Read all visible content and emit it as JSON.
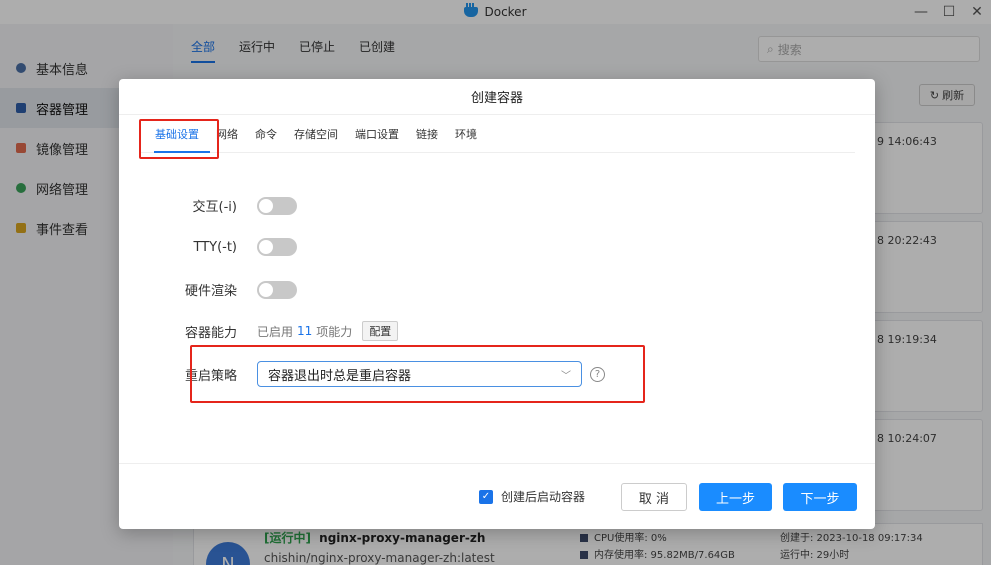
{
  "window": {
    "title": "Docker",
    "min": "—",
    "max": "☐",
    "close": "✕"
  },
  "sidebar": {
    "items": [
      {
        "label": "基本信息",
        "color": "#4a6fa5"
      },
      {
        "label": "容器管理",
        "color": "#2f5da8"
      },
      {
        "label": "镜像管理",
        "color": "#e06a4e"
      },
      {
        "label": "网络管理",
        "color": "#3aa35a"
      },
      {
        "label": "事件查看",
        "color": "#d9a520"
      }
    ]
  },
  "main": {
    "tabs": [
      "全部",
      "运行中",
      "已停止",
      "已创建"
    ],
    "search_placeholder": "搜索",
    "refresh_label": "刷新",
    "card_times": [
      "9 14:06:43",
      "8 20:22:43",
      "8 19:19:34",
      "8 10:24:07"
    ],
    "bottom_card": {
      "avatar": "N",
      "status": "[运行中]",
      "name": "nginx-proxy-manager-zh",
      "image": "chishin/nginx-proxy-manager-zh:latest",
      "cpu": "CPU使用率: 0%",
      "mem": "内存使用率: 95.82MB/7.64GB",
      "created": "创建于:  2023-10-18 09:17:34",
      "uptime": "运行中:  29小时"
    }
  },
  "dialog": {
    "title": "创建容器",
    "tabs": [
      "基础设置",
      "网络",
      "命令",
      "存储空间",
      "端口设置",
      "链接",
      "环境"
    ],
    "fields": {
      "interactive_label": "交互(-i)",
      "tty_label": "TTY(-t)",
      "hw_render_label": "硬件渲染",
      "capabilities_label": "容器能力",
      "capabilities_prefix": "已启用",
      "capabilities_count": "11",
      "capabilities_suffix": "项能力",
      "config_button": "配置",
      "restart_label": "重启策略",
      "restart_value": "容器退出时总是重启容器"
    },
    "footer": {
      "start_after_create": "创建后启动容器",
      "cancel": "取 消",
      "prev": "上一步",
      "next": "下一步"
    }
  }
}
